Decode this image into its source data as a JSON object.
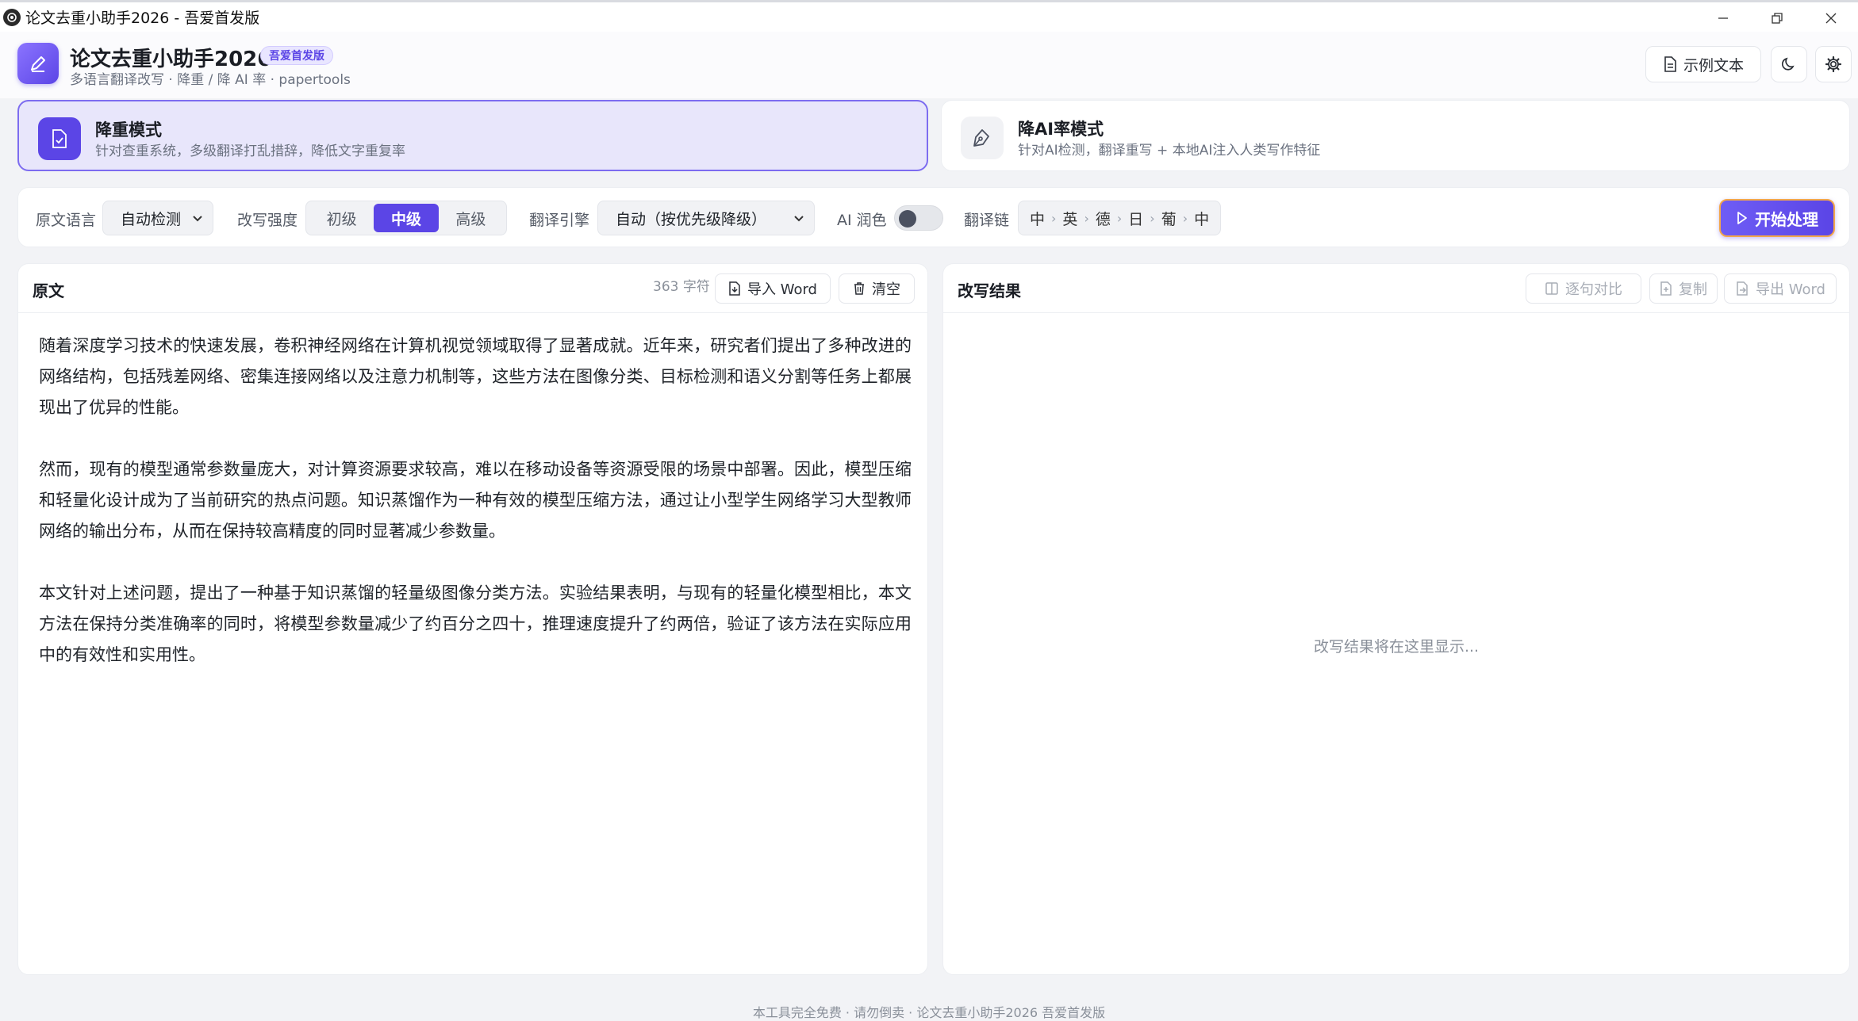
{
  "window": {
    "title": "论文去重小助手2026 - 吾爱首发版"
  },
  "header": {
    "app_title": "论文去重小助手2026",
    "badge": "吾爱首发版",
    "subtitle": "多语言翻译改写 · 降重 / 降 AI 率 · papertools",
    "sample_text_label": "示例文本"
  },
  "modes": [
    {
      "title": "降重模式",
      "desc": "针对查重系统，多级翻译打乱措辞，降低文字重复率",
      "active": true
    },
    {
      "title": "降AI率模式",
      "desc": "针对AI检测，翻译重写 + 本地AI注入人类写作特征",
      "active": false
    }
  ],
  "toolbar": {
    "source_lang_label": "原文语言",
    "source_lang_value": "自动检测",
    "strength_label": "改写强度",
    "strength_options": [
      "初级",
      "中级",
      "高级"
    ],
    "strength_selected": "中级",
    "engine_label": "翻译引擎",
    "engine_value": "自动（按优先级降级）",
    "ai_polish_label": "AI 润色",
    "ai_polish_on": false,
    "chain_label": "翻译链",
    "chain": [
      "中",
      "英",
      "德",
      "日",
      "葡",
      "中"
    ],
    "start_label": "开始处理"
  },
  "source_panel": {
    "title": "原文",
    "char_count": "363 字符",
    "import_label": "导入 Word",
    "clear_label": "清空",
    "paragraphs": [
      "随着深度学习技术的快速发展，卷积神经网络在计算机视觉领域取得了显著成就。近年来，研究者们提出了多种改进的网络结构，包括残差网络、密集连接网络以及注意力机制等，这些方法在图像分类、目标检测和语义分割等任务上都展现出了优异的性能。",
      "然而，现有的模型通常参数量庞大，对计算资源要求较高，难以在移动设备等资源受限的场景中部署。因此，模型压缩和轻量化设计成为了当前研究的热点问题。知识蒸馏作为一种有效的模型压缩方法，通过让小型学生网络学习大型教师网络的输出分布，从而在保持较高精度的同时显著减少参数量。",
      "本文针对上述问题，提出了一种基于知识蒸馏的轻量级图像分类方法。实验结果表明，与现有的轻量化模型相比，本文方法在保持分类准确率的同时，将模型参数量减少了约百分之四十，推理速度提升了约两倍，验证了该方法在实际应用中的有效性和实用性。"
    ]
  },
  "result_panel": {
    "title": "改写结果",
    "compare_label": "逐句对比",
    "copy_label": "复制",
    "export_label": "导出 Word",
    "placeholder": "改写结果将在这里显示..."
  },
  "footer": {
    "text": "本工具完全免费 · 请勿倒卖 · 论文去重小助手2026 吾爱首发版"
  },
  "colors": {
    "accent": "#5b45e6",
    "active_mode_bg": "#e8e6fb",
    "start_border": "#f3a74b"
  }
}
